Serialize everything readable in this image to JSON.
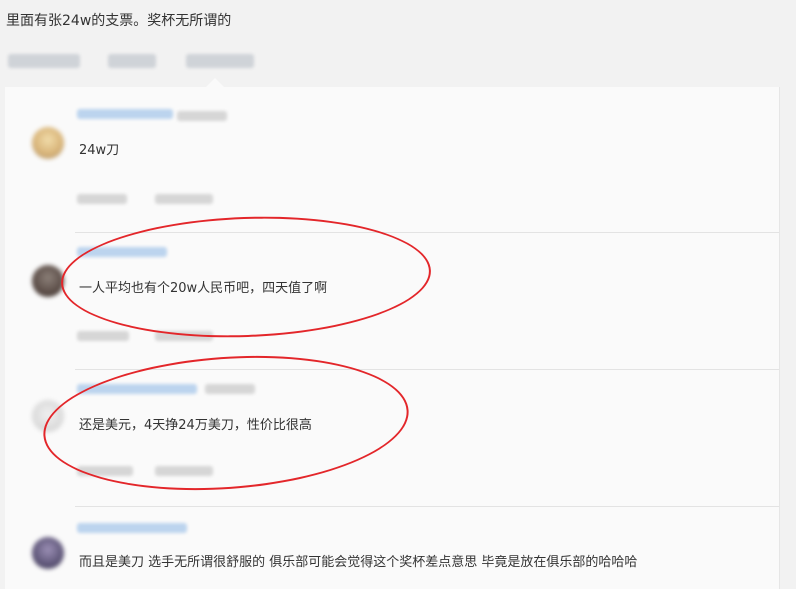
{
  "post": {
    "text": "里面有张24w的支票。奖杯无所谓的"
  },
  "comments": [
    {
      "text": "24w刀"
    },
    {
      "text": "一人平均也有个20w人民币吧，四天值了啊"
    },
    {
      "text": "还是美元，4天挣24万美刀，性价比很高"
    },
    {
      "text": "而且是美刀 选手无所谓很舒服的 俱乐部可能会觉得这个奖杯差点意思 毕竟是放在俱乐部的哈哈哈"
    }
  ],
  "colors": {
    "background": "#f2f2f2",
    "panel": "#fafafa",
    "highlight": "#e3262a",
    "username_blur": "#bcd4ee"
  }
}
